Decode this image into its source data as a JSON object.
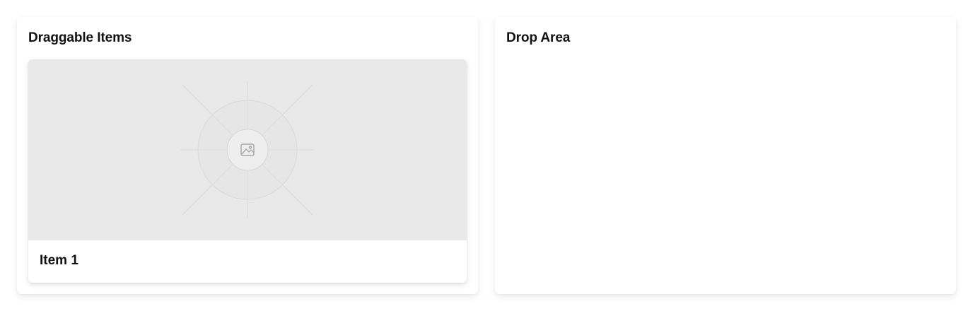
{
  "draggable_panel": {
    "title": "Draggable Items",
    "items": [
      {
        "label": "Item 1",
        "image_icon": "image-placeholder-icon"
      }
    ]
  },
  "drop_panel": {
    "title": "Drop Area"
  },
  "colors": {
    "page_background": "#ffffff",
    "panel_background": "#ffffff",
    "placeholder_background": "#e9e9e9",
    "placeholder_lines": "#d9d9d9",
    "text": "#111111"
  }
}
